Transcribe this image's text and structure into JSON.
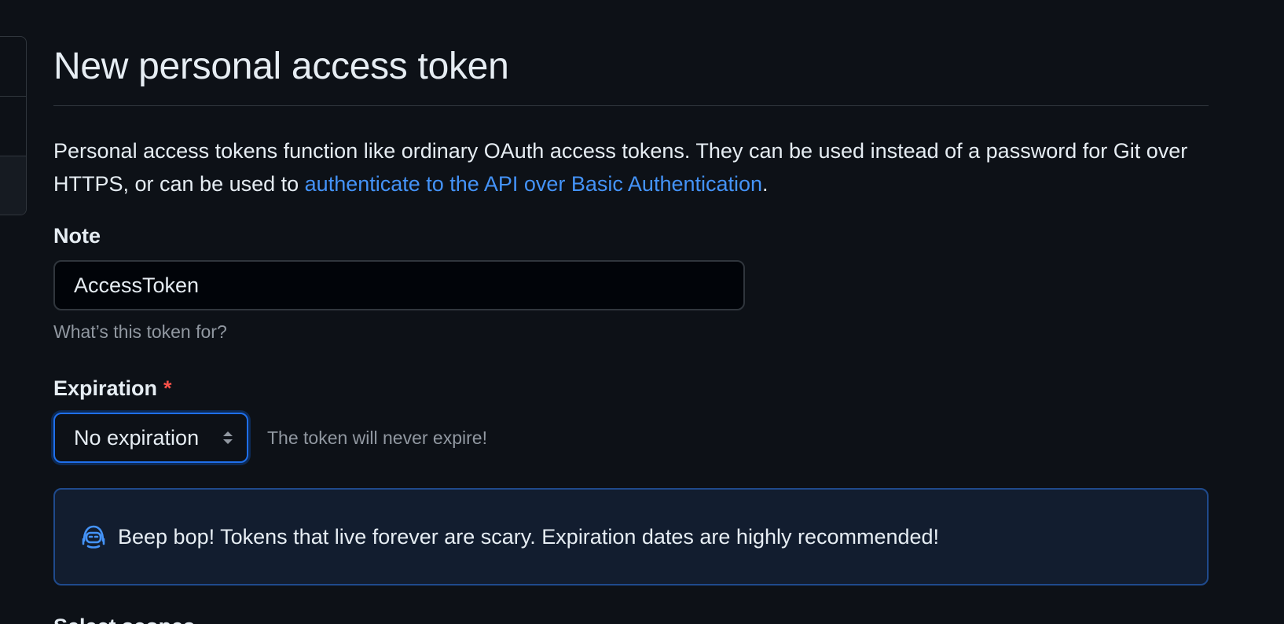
{
  "header": {
    "title": "New personal access token"
  },
  "intro": {
    "text_before": "Personal access tokens function like ordinary OAuth access tokens. They can be used instead of a password for Git over HTTPS, or can be used to ",
    "link_text": "authenticate to the API over Basic Authentication",
    "text_after": "."
  },
  "note": {
    "label": "Note",
    "value": "AccessToken",
    "hint": "What’s this token for?"
  },
  "expiration": {
    "label": "Expiration",
    "required_mark": "*",
    "selected": "No expiration",
    "note": "The token will never expire!"
  },
  "flash": {
    "icon": "copilot-bot-icon",
    "message": "Beep bop! Tokens that live forever are scary. Expiration dates are highly recommended!"
  },
  "next_section": {
    "heading": "Select scopes"
  },
  "colors": {
    "background": "#0d1117",
    "link": "#4493f8",
    "required": "#f85149",
    "focus_border": "#1f6feb",
    "flash_bg": "#121d2f",
    "flash_border": "#1f4a8c"
  }
}
